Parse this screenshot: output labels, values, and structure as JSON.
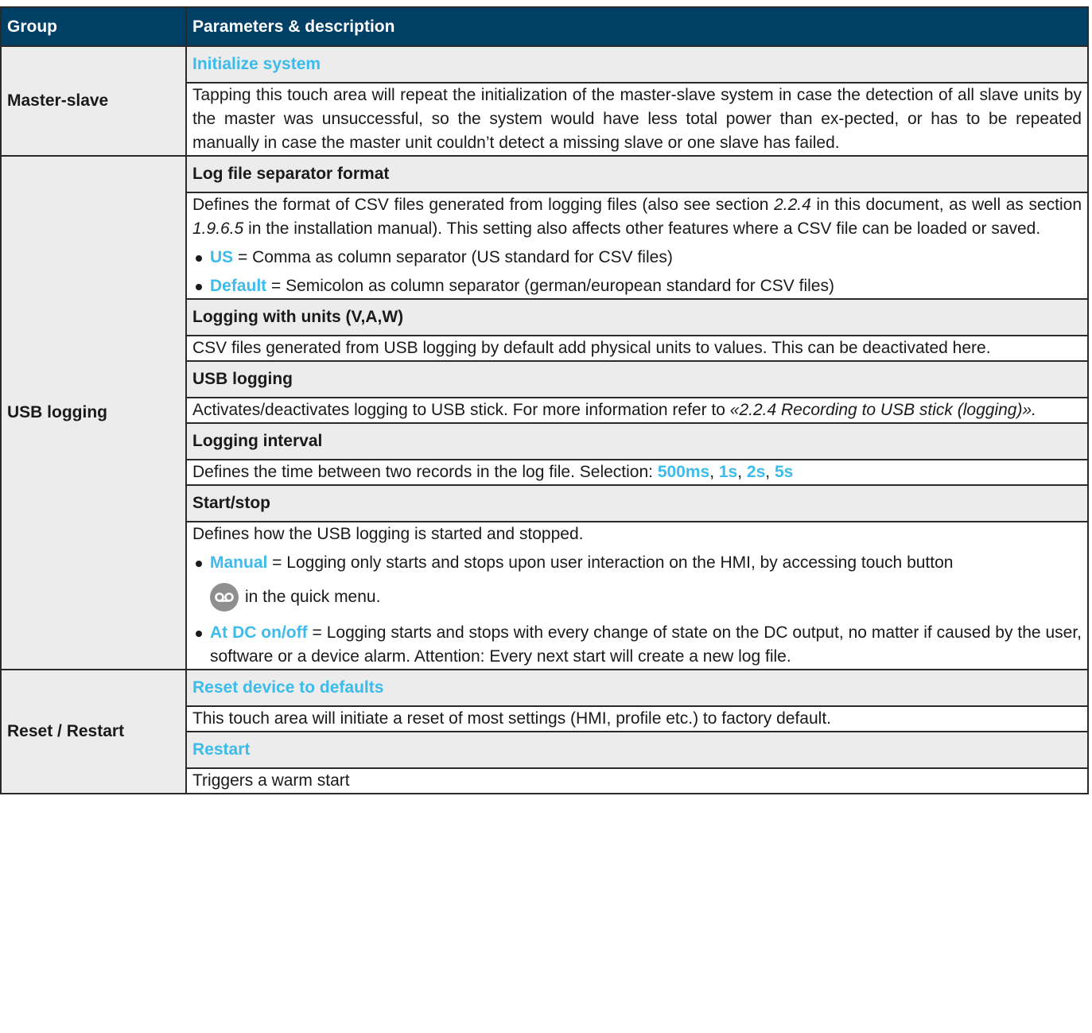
{
  "header": {
    "col1": "Group",
    "col2": "Parameters & description"
  },
  "master_slave": {
    "group": "Master-slave",
    "p1_title": "Initialize system",
    "p1_desc": "Tapping this touch area will repeat the initialization of the master-slave system in case the detection of all slave units by the master was unsuccessful, so the system would have less total power than ex-pected, or has to be repeated manually in case the master unit couldn’t detect a missing slave or one slave has failed."
  },
  "usb": {
    "group": "USB logging",
    "sep_title": "Log file separator format",
    "sep_t1": "Defines the format of CSV files generated from logging files (also see section ",
    "sep_ref1": "2.2.4",
    "sep_t2": " in this document, as well as section ",
    "sep_ref2": "1.9.6.5",
    "sep_t3": " in the installation manual). This setting also affects other features where a CSV file can be loaded or saved.",
    "sep_b1_key": "US",
    "sep_b1_text": " = Comma as column separator (US standard for CSV files)",
    "sep_b2_key": "Default",
    "sep_b2_text": " = Semicolon as column separator (german/european standard for CSV files)",
    "units_title": "Logging with units (V,A,W)",
    "units_desc": "CSV files generated from USB logging by default add physical units to values. This can be deactivated here.",
    "log_title": "USB logging",
    "log_t1": "Activates/deactivates logging to USB stick. For more information refer to ",
    "log_ref": "«2.2.4 Recording to USB stick (logging)».",
    "int_title": "Logging interval",
    "int_t1": "Defines the time between two records in the log file. Selection: ",
    "int_opts": [
      "500ms",
      "1s",
      "2s",
      "5s"
    ],
    "int_sep": ", ",
    "ss_title": "Start/stop",
    "ss_t1": "Defines how the USB logging is started and stopped.",
    "ss_b1_key": "Manual",
    "ss_b1_text": " = Logging only starts and stops upon user interaction on the HMI, by accessing touch button",
    "ss_b1_icon": "cassette-tape-icon",
    "ss_b1_after": "in the quick menu.",
    "ss_b2_key": "At DC on/off",
    "ss_b2_text": " = Logging starts and stops with every change of state on the DC output, no matter if caused by the user, software or a device alarm. Attention: Every next start will create a new log file."
  },
  "reset": {
    "group": "Reset / Restart",
    "r1_title": "Reset device to defaults",
    "r1_desc": "This touch area will initiate a reset of most settings (HMI, profile etc.) to factory default.",
    "r2_title": "Restart",
    "r2_desc": "Triggers a warm start"
  },
  "colors": {
    "header_bg": "#003f66",
    "accent": "#3dbbea",
    "param_bg": "#ececec"
  }
}
